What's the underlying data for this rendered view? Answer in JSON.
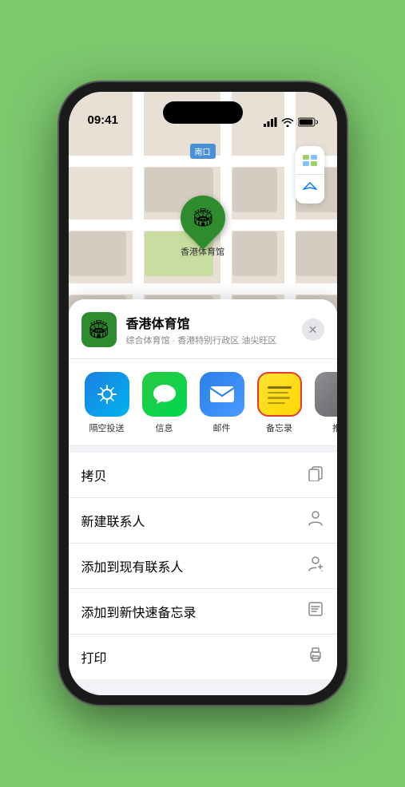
{
  "status": {
    "time": "09:41",
    "location_arrow": true
  },
  "map": {
    "label": "南口",
    "marker_label": "香港体育馆",
    "marker_emoji": "🏟"
  },
  "sheet": {
    "location_name": "香港体育馆",
    "location_desc": "综合体育馆 · 香港特别行政区 油尖旺区",
    "close_label": "✕"
  },
  "share_items": [
    {
      "id": "airdrop",
      "label": "隔空投送"
    },
    {
      "id": "messages",
      "label": "信息"
    },
    {
      "id": "mail",
      "label": "邮件"
    },
    {
      "id": "notes",
      "label": "备忘录"
    },
    {
      "id": "more",
      "label": "推"
    }
  ],
  "actions": [
    {
      "label": "拷贝",
      "icon": "📋"
    },
    {
      "label": "新建联系人",
      "icon": "👤"
    },
    {
      "label": "添加到现有联系人",
      "icon": "👤"
    },
    {
      "label": "添加到新快速备忘录",
      "icon": "📝"
    },
    {
      "label": "打印",
      "icon": "🖨"
    }
  ],
  "colors": {
    "green": "#2e8b2e",
    "blue": "#007aff",
    "red": "#e53935"
  }
}
